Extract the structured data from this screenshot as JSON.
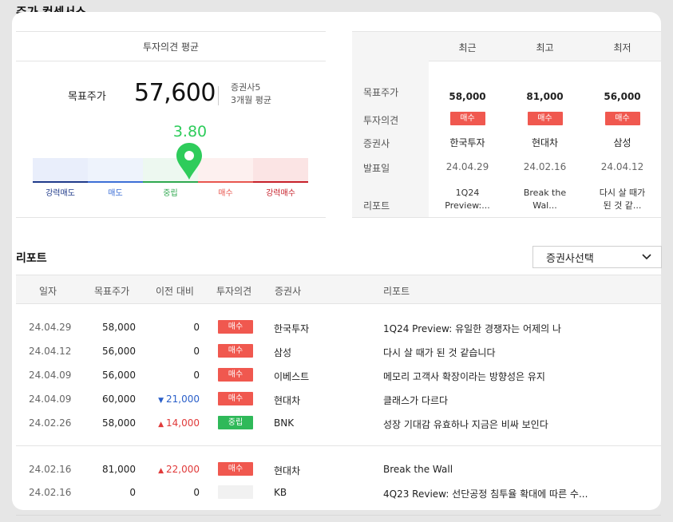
{
  "page": {
    "heading": "주가 컨센서스"
  },
  "consensus": {
    "title": "투자의견 평균",
    "target_label": "목표주가",
    "target_value": "57,600",
    "broker_count": "증권사5",
    "period": "3개월 평균",
    "score": "3.80",
    "gauge": [
      {
        "label": "강력매도",
        "color": "#1f3a8a",
        "bg": "#e9eefb"
      },
      {
        "label": "매도",
        "color": "#3d6fd6",
        "bg": "#eef3fc"
      },
      {
        "label": "중립",
        "color": "#2fa84f",
        "bg": "#edf8f0"
      },
      {
        "label": "매수",
        "color": "#e8574f",
        "bg": "#fdf0ef"
      },
      {
        "label": "강력매수",
        "color": "#c7202a",
        "bg": "#fbe4e4"
      }
    ]
  },
  "summary": {
    "columns": [
      "최근",
      "최고",
      "최저"
    ],
    "row_labels": {
      "target": "목표주가",
      "opinion": "투자의견",
      "broker": "증권사",
      "date": "발표일",
      "report": "리포트"
    },
    "recent": {
      "target": "58,000",
      "opinion": "매수",
      "broker": "한국투자",
      "date": "24.04.29",
      "report_l1": "1Q24",
      "report_l2": "Preview:..."
    },
    "high": {
      "target": "81,000",
      "opinion": "매수",
      "broker": "현대차",
      "date": "24.02.16",
      "report_l1": "Break the",
      "report_l2": "Wal..."
    },
    "low": {
      "target": "56,000",
      "opinion": "매수",
      "broker": "삼성",
      "date": "24.04.12",
      "report_l1": "다시 살 때가",
      "report_l2": "된 것 같..."
    }
  },
  "reports": {
    "title": "리포트",
    "broker_select": "증권사선택",
    "headers": {
      "date": "일자",
      "target": "목표주가",
      "change": "이전 대비",
      "opinion": "투자의견",
      "broker": "증권사",
      "report": "리포트"
    },
    "rows": [
      {
        "date": "24.04.29",
        "target": "58,000",
        "change": "0",
        "opinion": "매수",
        "broker": "한국투자",
        "report": "1Q24 Preview: 유일한 경쟁자는 어제의 나"
      },
      {
        "date": "24.04.12",
        "target": "56,000",
        "change": "0",
        "opinion": "매수",
        "broker": "삼성",
        "report": "다시 살 때가 된 것 같습니다"
      },
      {
        "date": "24.04.09",
        "target": "56,000",
        "change": "0",
        "opinion": "매수",
        "broker": "이베스트",
        "report": "메모리 고객사 확장이라는 방향성은 유지"
      },
      {
        "date": "24.04.09",
        "target": "60,000",
        "change": "21,000",
        "opinion": "매수",
        "broker": "현대차",
        "report": "클래스가 다르다"
      },
      {
        "date": "24.02.26",
        "target": "58,000",
        "change": "14,000",
        "opinion": "중립",
        "broker": "BNK",
        "report": "성장 기대감 유효하나 지금은 비싸 보인다"
      },
      {
        "date": "24.02.16",
        "target": "81,000",
        "change": "22,000",
        "opinion": "매수",
        "broker": "현대차",
        "report": "Break the Wall"
      },
      {
        "date": "24.02.16",
        "target": "0",
        "change": "0",
        "opinion": "",
        "broker": "KB",
        "report": "4Q23 Review: 선단공정 침투율 확대에 따른 수..."
      }
    ]
  }
}
